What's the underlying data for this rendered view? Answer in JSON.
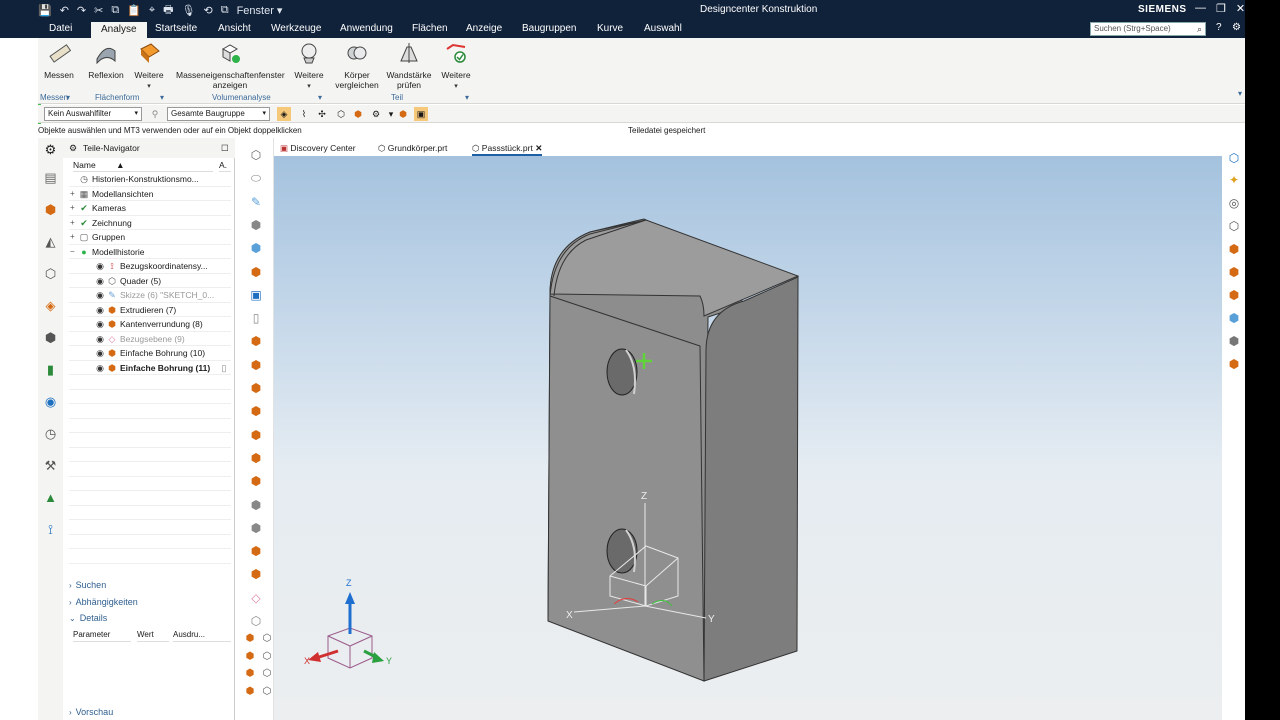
{
  "titlebar": {
    "window_menu": "Fenster ▾",
    "app_title": "Designcenter Konstruktion",
    "brand": "SIEMENS"
  },
  "menubar": {
    "items": [
      "Datei",
      "Analyse",
      "Startseite",
      "Ansicht",
      "Werkzeuge",
      "Anwendung",
      "Flächen",
      "Anzeige",
      "Baugruppen",
      "Kurve",
      "Auswahl"
    ],
    "active": "Analyse",
    "search_placeholder": "Suchen (Strg+Space)"
  },
  "ribbon": {
    "buttons": {
      "messen": "Messen",
      "reflexion": "Reflexion",
      "weitere1": "Weitere",
      "masse1": "Masseneigenschaftenfenster",
      "masse2": "anzeigen",
      "weitere2": "Weitere",
      "koerper1": "Körper",
      "koerper2": "vergleichen",
      "wand1": "Wandstärke",
      "wand2": "prüfen",
      "weitere3": "Weitere"
    },
    "groups": {
      "messen": "Messen",
      "flaechenform": "Flächenform",
      "volumenanalyse": "Volumenanalyse",
      "teil": "Teil"
    }
  },
  "selection_bar": {
    "filter": "Kein Auswahlfilter",
    "scope": "Gesamte Baugruppe"
  },
  "status": {
    "left": "Objekte auswählen und MT3 verwenden oder auf ein Objekt doppelklicken",
    "right": "Teiledatei gespeichert"
  },
  "navigator": {
    "title": "Teile-Navigator",
    "col_name": "Name",
    "col_a": "A.",
    "rows": [
      {
        "label": "Historien-Konstruktionsmo..."
      },
      {
        "label": "Modellansichten"
      },
      {
        "label": "Kameras"
      },
      {
        "label": "Zeichnung"
      },
      {
        "label": "Gruppen"
      },
      {
        "label": "Modellhistorie"
      },
      {
        "label": "Bezugskoordinatensy..."
      },
      {
        "label": "Quader (5)"
      },
      {
        "label": "Skizze (6) \"SKETCH_0..."
      },
      {
        "label": "Extrudieren (7)"
      },
      {
        "label": "Kantenverrundung (8)"
      },
      {
        "label": "Bezugsebene (9)"
      },
      {
        "label": "Einfache Bohrung (10)"
      },
      {
        "label": "Einfache Bohrung (11)"
      }
    ],
    "sections": {
      "suchen": "Suchen",
      "abhaengigkeiten": "Abhängigkeiten",
      "details": "Details",
      "vorschau": "Vorschau"
    },
    "details_cols": [
      "Parameter",
      "Wert",
      "Ausdru..."
    ]
  },
  "tabs": [
    {
      "label": "Discovery Center"
    },
    {
      "label": "Grundkörper.prt"
    },
    {
      "label": "Passstück.prt"
    }
  ],
  "viewport": {
    "axis_x": "X",
    "axis_y": "Y",
    "axis_z": "Z"
  }
}
